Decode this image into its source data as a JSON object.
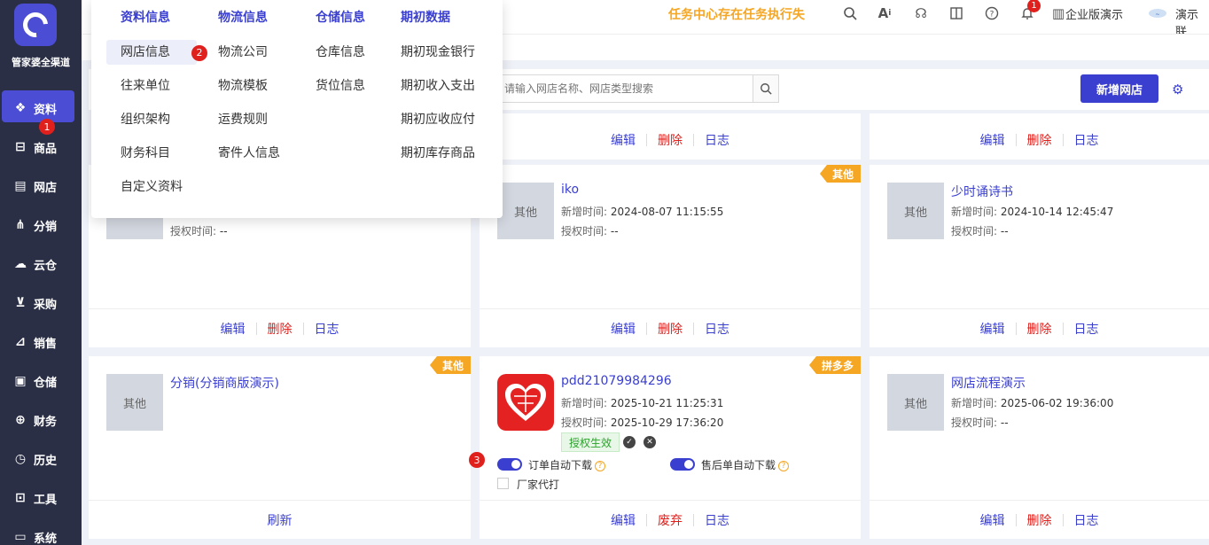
{
  "brand": {
    "name": "管家婆全渠道"
  },
  "sidebar": {
    "items": [
      {
        "label": "资料",
        "icon": "layers-icon",
        "glyph": "❖",
        "active": true,
        "badge": "1"
      },
      {
        "label": "商品",
        "icon": "box-icon",
        "glyph": "⊟"
      },
      {
        "label": "网店",
        "icon": "document-icon",
        "glyph": "▤"
      },
      {
        "label": "分销",
        "icon": "network-icon",
        "glyph": "⋔"
      },
      {
        "label": "云仓",
        "icon": "cloud-icon",
        "glyph": "☁"
      },
      {
        "label": "采购",
        "icon": "cart-icon",
        "glyph": "⊻"
      },
      {
        "label": "销售",
        "icon": "chart-icon",
        "glyph": "⊿"
      },
      {
        "label": "仓储",
        "icon": "warehouse-icon",
        "glyph": "▣"
      },
      {
        "label": "财务",
        "icon": "finance-icon",
        "glyph": "⊕"
      },
      {
        "label": "历史",
        "icon": "clock-icon",
        "glyph": "◷"
      },
      {
        "label": "工具",
        "icon": "toolbox-icon",
        "glyph": "⊡"
      },
      {
        "label": "系统",
        "icon": "monitor-icon",
        "glyph": "▭"
      }
    ]
  },
  "topbar": {
    "notice": "任务中心存在任务执行失",
    "notify_badge": "1",
    "edition": "企业版演示",
    "user": "演示联"
  },
  "dropdown": {
    "columns": [
      {
        "head": "资料信息",
        "items": [
          "网店信息",
          "往来单位",
          "组织架构",
          "财务科目",
          "自定义资料"
        ]
      },
      {
        "head": "物流信息",
        "items": [
          "物流公司",
          "物流模板",
          "运费规则",
          "寄件人信息"
        ]
      },
      {
        "head": "仓储信息",
        "items": [
          "仓库信息",
          "货位信息"
        ]
      },
      {
        "head": "期初数据",
        "items": [
          "期初现金银行",
          "期初收入支出",
          "期初应收应付",
          "期初库存商品"
        ]
      }
    ],
    "active_badge": "2"
  },
  "toolbar": {
    "search_placeholder": "请输入网店名称、网店类型搜索",
    "add_button": "新增网店"
  },
  "labels": {
    "edit": "编辑",
    "delete": "删除",
    "log": "日志",
    "refresh": "刷新",
    "discard": "废弃",
    "added_time": "新增时间:",
    "auth_time": "授权时间:",
    "thumb_other": "其他",
    "auth_effective": "授权生效",
    "order_auto": "订单自动下载",
    "aftersale_auto": "售后单自动下载",
    "factory_print": "厂家代打",
    "step3_badge": "3"
  },
  "cards": {
    "r1c1": {
      "auth": "--"
    },
    "r1c2": {
      "name": "iko",
      "tag": "其他",
      "added": "2024-08-07 11:15:55",
      "auth": "--"
    },
    "r1c3": {
      "name": "少时诵诗书",
      "added": "2024-10-14 12:45:47",
      "auth": "--"
    },
    "r2c1": {
      "name": "分销(分销商版演示)",
      "tag": "其他"
    },
    "r2c2": {
      "name": "pdd21079984296",
      "tag": "拼多多",
      "added": "2025-10-21 11:25:31",
      "auth": "2025-10-29 17:36:20"
    },
    "r2c3": {
      "name": "网店流程演示",
      "added": "2025-06-02 19:36:00",
      "auth": "--"
    }
  },
  "colors": {
    "accent": "#3a3fd0",
    "danger": "#e0201c",
    "tag": "#f5a623",
    "sidebar": "#2a2f45"
  }
}
